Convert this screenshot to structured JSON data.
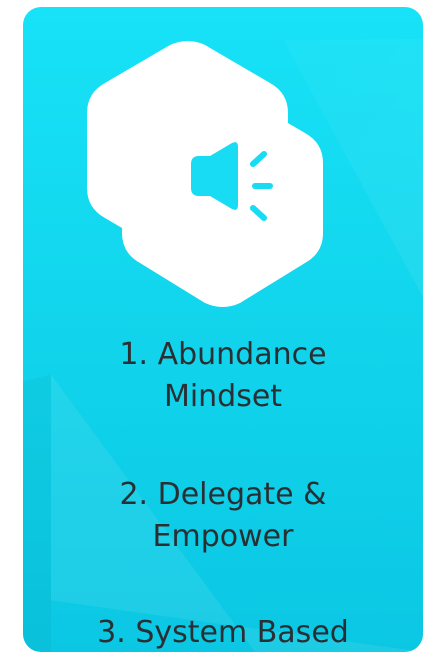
{
  "card": {
    "background_color": "#14dbf2"
  },
  "icon": {
    "name": "megaphone-icon",
    "hexagon_color": "#ffffff",
    "glyph_color": "#17dcf4"
  },
  "items": [
    {
      "line1": "1. Abundance",
      "line2": "Mindset"
    },
    {
      "line1": "2. Delegate &",
      "line2": "Empower"
    },
    {
      "line1": "3. System Based"
    }
  ]
}
